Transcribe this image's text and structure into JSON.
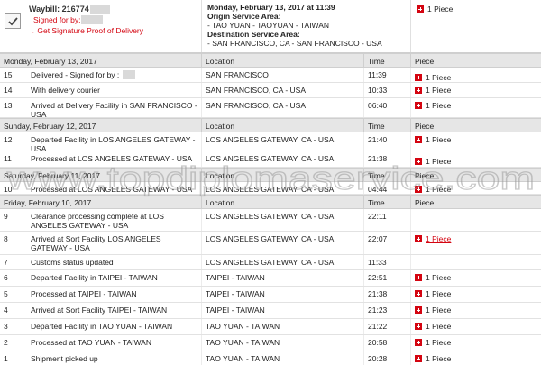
{
  "summary": {
    "waybill_label": "Waybill: 216774",
    "signed_label": "Signed for by:",
    "signature_link": "Get Signature Proof of Delivery",
    "arrow": "→",
    "delivered_datetime": "Monday, February 13, 2017 at 11:39",
    "origin_label": "Origin Service Area:",
    "origin_value": "- TAO YUAN - TAOYUAN - TAIWAN",
    "destination_label": "Destination Service Area:",
    "destination_value": "- SAN FRANCISCO, CA - SAN FRANCISCO - USA",
    "piece_label": "1 Piece"
  },
  "columns": {
    "location": "Location",
    "time": "Time",
    "piece": "Piece"
  },
  "groups": [
    {
      "date": "Monday, February 13, 2017",
      "events": [
        {
          "num": "15",
          "desc": "Delivered - Signed for by :",
          "location": "SAN FRANCISCO",
          "time": "11:39",
          "piece": "1 Piece"
        },
        {
          "num": "14",
          "desc": "With delivery courier",
          "location": "SAN FRANCISCO, CA - USA",
          "time": "10:33",
          "piece": "1 Piece"
        },
        {
          "num": "13",
          "desc": "Arrived at Delivery Facility in SAN FRANCISCO - USA",
          "location": "SAN FRANCISCO, CA - USA",
          "time": "06:40",
          "piece": "1 Piece"
        }
      ]
    },
    {
      "date": "Sunday, February 12, 2017",
      "events": [
        {
          "num": "12",
          "desc": "Departed Facility in LOS ANGELES GATEWAY - USA",
          "location": "LOS ANGELES GATEWAY, CA - USA",
          "time": "21:40",
          "piece": "1 Piece"
        },
        {
          "num": "11",
          "desc": "Processed at LOS ANGELES GATEWAY - USA",
          "location": "LOS ANGELES GATEWAY, CA - USA",
          "time": "21:38",
          "piece": "1 Piece"
        }
      ]
    },
    {
      "date": "Saturday, February 11, 2017",
      "events": [
        {
          "num": "10",
          "desc": "Processed at LOS ANGELES GATEWAY - USA",
          "location": "LOS ANGELES GATEWAY, CA - USA",
          "time": "04:44",
          "piece": "1 Piece"
        }
      ]
    },
    {
      "date": "Friday, February 10, 2017",
      "events": [
        {
          "num": "9",
          "desc": "Clearance processing complete at LOS ANGELES GATEWAY - USA",
          "location": "LOS ANGELES GATEWAY, CA - USA",
          "time": "22:11",
          "piece": ""
        },
        {
          "num": "8",
          "desc": "Arrived at Sort Facility LOS ANGELES GATEWAY - USA",
          "location": "LOS ANGELES GATEWAY, CA - USA",
          "time": "22:07",
          "piece": "1 Piece"
        },
        {
          "num": "7",
          "desc": "Customs status updated",
          "location": "LOS ANGELES GATEWAY, CA - USA",
          "time": "11:33",
          "piece": ""
        },
        {
          "num": "6",
          "desc": "Departed Facility in TAIPEI - TAIWAN",
          "location": "TAIPEI - TAIWAN",
          "time": "22:51",
          "piece": "1 Piece"
        },
        {
          "num": "5",
          "desc": "Processed at TAIPEI - TAIWAN",
          "location": "TAIPEI - TAIWAN",
          "time": "21:38",
          "piece": "1 Piece"
        },
        {
          "num": "4",
          "desc": "Arrived at Sort Facility TAIPEI - TAIWAN",
          "location": "TAIPEI - TAIWAN",
          "time": "21:23",
          "piece": "1 Piece"
        },
        {
          "num": "3",
          "desc": "Departed Facility in TAO YUAN - TAIWAN",
          "location": "TAO YUAN - TAIWAN",
          "time": "21:22",
          "piece": "1 Piece"
        },
        {
          "num": "2",
          "desc": "Processed at TAO YUAN - TAIWAN",
          "location": "TAO YUAN - TAIWAN",
          "time": "20:58",
          "piece": "1 Piece"
        },
        {
          "num": "1",
          "desc": "Shipment picked up",
          "location": "TAO YUAN - TAIWAN",
          "time": "20:28",
          "piece": "1 Piece"
        }
      ]
    }
  ],
  "watermark": "www.topdiplomaservice.com",
  "colors": {
    "accent": "#d40511",
    "header_bg": "#e6e6e6"
  }
}
